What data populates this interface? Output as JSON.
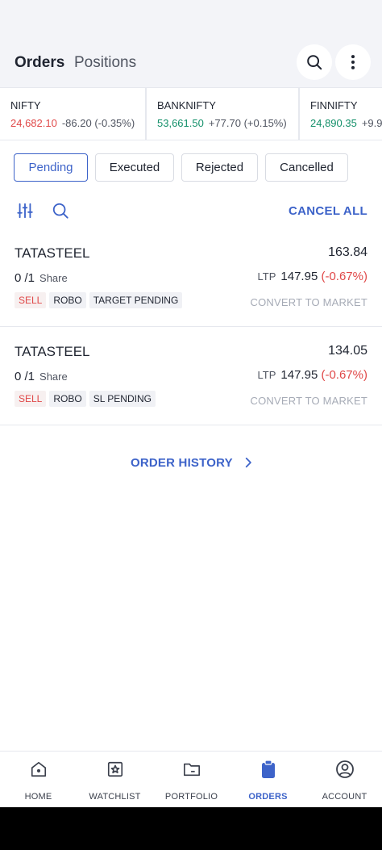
{
  "header": {
    "tabs": [
      {
        "label": "Orders",
        "active": true
      },
      {
        "label": "Positions",
        "active": false
      }
    ],
    "icons": {
      "search": "search-icon",
      "more": "more-vertical-icon"
    }
  },
  "indices": [
    {
      "name": "NIFTY",
      "price": "24,682.10",
      "change": "-86.20 (-0.35%)",
      "trend": "down"
    },
    {
      "name": "BANKNIFTY",
      "price": "53,661.50",
      "change": "+77.70 (+0.15%)",
      "trend": "up"
    },
    {
      "name": "FINNIFTY",
      "price": "24,890.35",
      "change": "+9.9",
      "trend": "up"
    }
  ],
  "filters": [
    {
      "label": "Pending",
      "active": true
    },
    {
      "label": "Executed",
      "active": false
    },
    {
      "label": "Rejected",
      "active": false
    },
    {
      "label": "Cancelled",
      "active": false
    }
  ],
  "toolbar": {
    "cancel_all": "CANCEL ALL",
    "icons": [
      "filter-sliders-icon",
      "search-icon"
    ]
  },
  "orders": [
    {
      "symbol": "TATASTEEL",
      "price": "163.84",
      "qty": "0 /1",
      "unit": "Share",
      "ltp_label": "LTP",
      "ltp": "147.95",
      "ltp_change": "(-0.67%)",
      "tags": [
        "SELL",
        "ROBO",
        "TARGET PENDING"
      ],
      "action": "CONVERT TO MARKET"
    },
    {
      "symbol": "TATASTEEL",
      "price": "134.05",
      "qty": "0 /1",
      "unit": "Share",
      "ltp_label": "LTP",
      "ltp": "147.95",
      "ltp_change": "(-0.67%)",
      "tags": [
        "SELL",
        "ROBO",
        "SL PENDING"
      ],
      "action": "CONVERT TO MARKET"
    }
  ],
  "order_history": {
    "label": "ORDER HISTORY"
  },
  "bottom_nav": [
    {
      "label": "HOME",
      "icon": "home-icon",
      "active": false
    },
    {
      "label": "WATCHLIST",
      "icon": "watchlist-star-icon",
      "active": false
    },
    {
      "label": "PORTFOLIO",
      "icon": "portfolio-folder-icon",
      "active": false
    },
    {
      "label": "ORDERS",
      "icon": "orders-clipboard-icon",
      "active": true
    },
    {
      "label": "ACCOUNT",
      "icon": "account-user-icon",
      "active": false
    }
  ],
  "colors": {
    "accent": "#3d63c9",
    "up": "#14906a",
    "down": "#e04848",
    "muted": "#a6abb6"
  }
}
